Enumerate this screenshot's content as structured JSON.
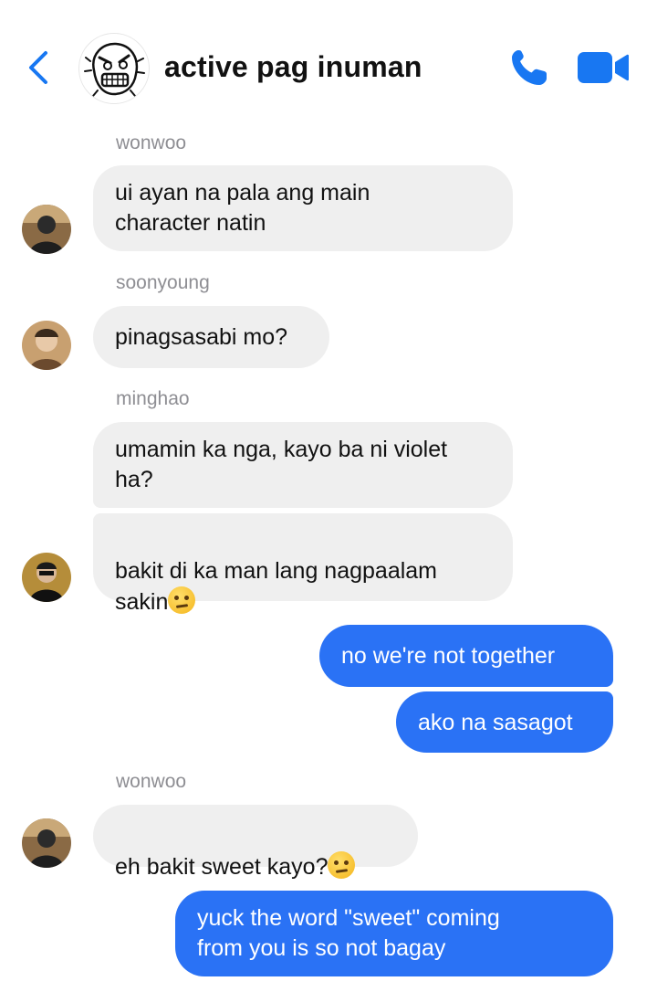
{
  "header": {
    "title": "active pag inuman",
    "back_icon": "chevron-left-icon",
    "call_icon": "phone-icon",
    "video_icon": "video-camera-icon",
    "accent_color": "#1877f2"
  },
  "messages": [
    {
      "sender": "wonwoo",
      "text": "ui ayan na pala ang main\ncharacter natin"
    },
    {
      "sender": "soonyoung",
      "text": "pinagsasabi mo?"
    },
    {
      "sender": "minghao",
      "text": "umamin ka nga, kayo ba ni violet\nha?"
    },
    {
      "sender": "minghao",
      "text": "bakit di ka man lang nagpaalam\nsakin",
      "emoji": "raised-eyebrow-emoji"
    },
    {
      "sender": "me",
      "text": "no we're not together"
    },
    {
      "sender": "me",
      "text": "ako na sasagot"
    },
    {
      "sender": "wonwoo",
      "text": "eh bakit sweet kayo?",
      "emoji": "raised-eyebrow-emoji"
    },
    {
      "sender": "me",
      "text": "yuck the word \"sweet\" coming\nfrom you is so not bagay"
    }
  ],
  "colors": {
    "incoming_bubble": "#efefef",
    "outgoing_bubble": "#2a72f5",
    "sender_name": "#8e8e93"
  }
}
